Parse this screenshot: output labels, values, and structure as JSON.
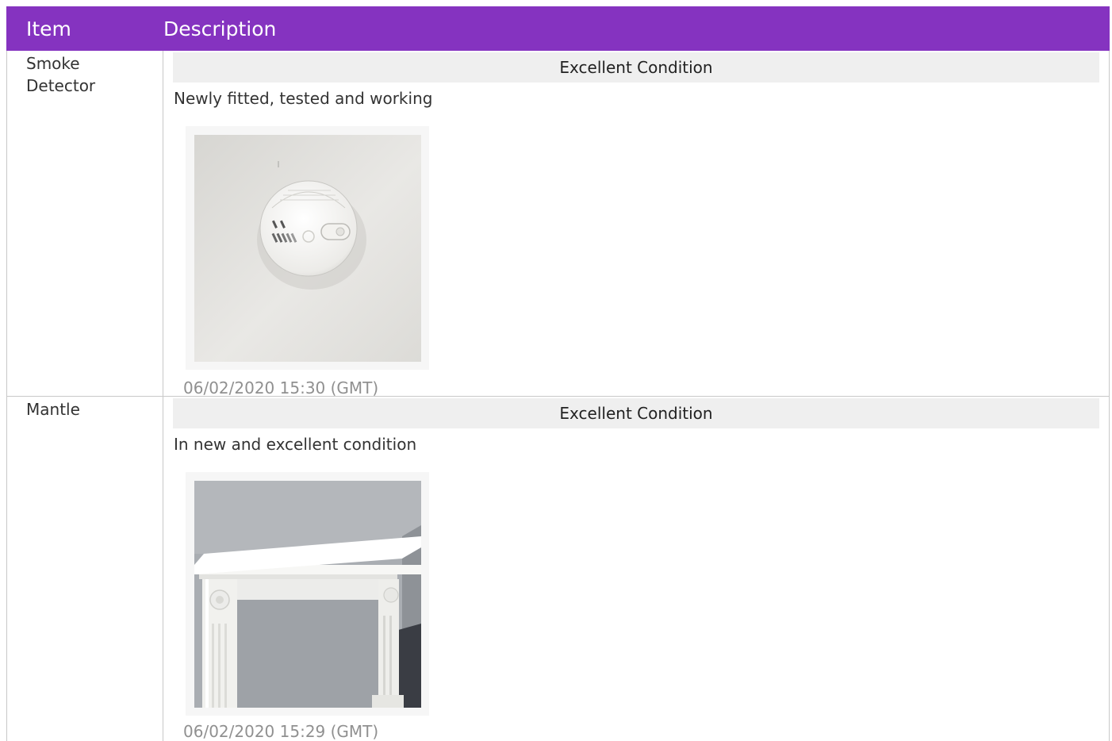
{
  "header": {
    "item_label": "Item",
    "description_label": "Description",
    "color": "#8533c0"
  },
  "rows": [
    {
      "item": "Smoke Detector",
      "condition": "Excellent Condition",
      "note": "Newly fitted, tested and working",
      "photo": "smoke-detector-photo",
      "timestamp": "06/02/2020 15:30 (GMT)"
    },
    {
      "item": "Mantle",
      "condition": "Excellent Condition",
      "note": "In new and excellent condition",
      "photo": "fireplace-mantle-photo",
      "timestamp": "06/02/2020 15:29 (GMT)"
    }
  ]
}
